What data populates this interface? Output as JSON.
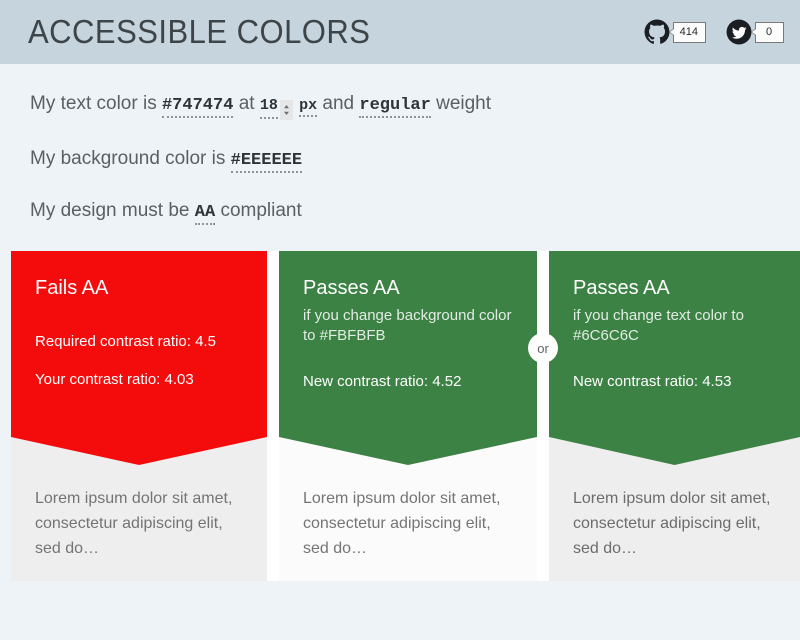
{
  "header": {
    "title": "ACCESSIBLE COLORS",
    "social": [
      {
        "icon": "github-icon",
        "name": "github",
        "count": "414"
      },
      {
        "icon": "twitter-icon",
        "name": "twitter",
        "count": "0"
      }
    ]
  },
  "form": {
    "line1": {
      "prefix": "My text color is",
      "text_color": "#747474",
      "mid": "at",
      "font_size": "18",
      "unit": "px",
      "and": "and",
      "weight": "regular",
      "suffix": "weight"
    },
    "line2": {
      "prefix": "My background color is",
      "background_color": "#EEEEEE"
    },
    "line3": {
      "prefix": "My design must be",
      "level": "AA",
      "suffix": "compliant"
    }
  },
  "divider": {
    "or_label": "or"
  },
  "results": [
    {
      "status": "Fails AA",
      "subtitle": "",
      "lines": [
        "Required contrast ratio: 4.5",
        "Your contrast ratio: 4.03"
      ],
      "band_color": "#F40C0C",
      "preview_text": "Lorem ipsum dolor sit amet, consectetur adipiscing elit, sed do…",
      "preview_bg": "#EEEEEE",
      "preview_fg": "#747474"
    },
    {
      "status": "Passes AA",
      "subtitle": "if you change background color to #FBFBFB",
      "lines": [
        "New contrast ratio: 4.52"
      ],
      "band_color": "#3C8244",
      "preview_text": "Lorem ipsum dolor sit amet, consectetur adipiscing elit, sed do…",
      "preview_bg": "#FBFBFB",
      "preview_fg": "#747474"
    },
    {
      "status": "Passes AA",
      "subtitle": "if you change text color to #6C6C6C",
      "lines": [
        "New contrast ratio: 4.53"
      ],
      "band_color": "#3C8244",
      "preview_text": "Lorem ipsum dolor sit amet, consectetur adipiscing elit, sed do…",
      "preview_bg": "#EEEEEE",
      "preview_fg": "#6C6C6C"
    }
  ]
}
